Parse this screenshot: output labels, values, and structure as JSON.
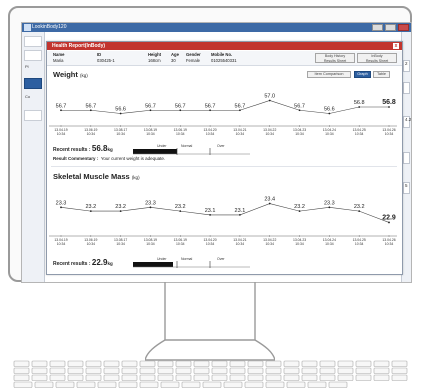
{
  "app": {
    "title": "LookinBody120"
  },
  "report": {
    "title": "Health Report(InBody)",
    "close_glyph": "x",
    "info": {
      "name_label": "Name",
      "name_value": "Maria",
      "id_label": "ID",
      "id_value": "030425-1",
      "height_label": "Height",
      "height_value": "168cm",
      "age_label": "Age",
      "age_value": "30",
      "gender_label": "Gender",
      "gender_value": "Female",
      "mobile_label": "Mobile No.",
      "mobile_value": "01025540331"
    },
    "history_buttons": [
      {
        "line1": "Body History",
        "line2": "Results Sheet"
      },
      {
        "line1": "InBody",
        "line2": "Results Sheet"
      }
    ]
  },
  "right_strip": {
    "items": [
      "2",
      "",
      "4.2",
      "",
      "5"
    ]
  },
  "left_panel": {
    "items": [
      "",
      "",
      "Pl",
      "",
      "Co",
      ""
    ]
  },
  "weight": {
    "title": "Weight",
    "unit": "(kg)",
    "buttons": [
      {
        "label": "Item Comparison",
        "active": false
      },
      {
        "label": "Graph",
        "active": true
      },
      {
        "label": "Table",
        "active": false
      }
    ],
    "recent_label": "Recent results :",
    "recent_value": "56.8",
    "recent_unit": "kg",
    "range_labels": [
      "Under",
      "Normal",
      "Over"
    ],
    "commentary_label": "Result Commentary :",
    "commentary_text": "Your current weight is adequate."
  },
  "smm": {
    "title": "Skeletal Muscle Mass",
    "unit": "(kg)",
    "recent_label": "Recent results :",
    "recent_value": "22.9",
    "recent_unit": "kg",
    "range_labels": [
      "Under",
      "Normal",
      "Over"
    ]
  },
  "chart_data": [
    {
      "type": "line",
      "title": "Weight",
      "ylabel": "(kg)",
      "categories": [
        "13.04.19 10:34",
        "13.06.19 10:34",
        "13.08.17 10:34",
        "13.08.19 10:34",
        "13.06.19 10:34",
        "13.04.20 10:34",
        "13.04.21 10:34",
        "13.04.22 10:34",
        "13.04.23 10:34",
        "13.04.24 10:34",
        "13.04.25 10:34",
        "13.04.26 10:34"
      ],
      "values": [
        56.7,
        56.7,
        56.6,
        56.7,
        56.7,
        56.7,
        56.7,
        57.0,
        56.7,
        56.6,
        56.8,
        56.8
      ],
      "value_labels": [
        "56.7",
        "56.7",
        "56.6",
        "56.7",
        "56.7",
        "56.7",
        "56.7",
        "57.0",
        "56.7",
        "56.6",
        "56.8",
        "56.8"
      ],
      "ylim": [
        56.4,
        57.2
      ]
    },
    {
      "type": "line",
      "title": "Skeletal Muscle Mass",
      "ylabel": "(kg)",
      "categories": [
        "13.04.19 10:34",
        "13.06.19 10:34",
        "13.08.17 10:34",
        "13.08.19 10:34",
        "13.06.19 10:34",
        "13.04.20 10:34",
        "13.04.21 10:34",
        "13.04.22 10:34",
        "13.04.23 10:34",
        "13.04.24 10:34",
        "13.04.25 10:34",
        "13.04.26 10:34"
      ],
      "values": [
        23.3,
        23.2,
        23.2,
        23.3,
        23.2,
        23.1,
        23.1,
        23.4,
        23.2,
        23.3,
        23.2,
        22.9
      ],
      "value_labels": [
        "23.3",
        "23.2",
        "23.2",
        "23.3",
        "23.2",
        "23.1",
        "23.1",
        "23.4",
        "23.2",
        "23.3",
        "23.2",
        "22.9"
      ],
      "ylim": [
        22.7,
        23.6
      ]
    }
  ]
}
